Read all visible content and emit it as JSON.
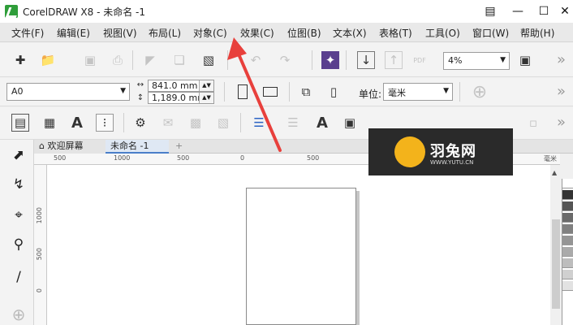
{
  "window": {
    "title": "CorelDRAW X8 - 未命名 -1",
    "buttons": {
      "minimize": "—",
      "maximize": "☐",
      "close": "✕"
    },
    "account_icon": "person-badge-icon",
    "help_icon": "lightbulb-icon"
  },
  "menubar": {
    "items": [
      "文件(F)",
      "编辑(E)",
      "视图(V)",
      "布局(L)",
      "对象(C)",
      "效果(C)",
      "位图(B)",
      "文本(X)",
      "表格(T)",
      "工具(O)",
      "窗口(W)",
      "帮助(H)"
    ]
  },
  "standard_toolbar": {
    "zoom_value": "4%",
    "pdf_label": "PDF",
    "icons": [
      "new-document-icon",
      "open-folder-icon",
      "save-icon",
      "print-icon",
      "cut-icon",
      "copy-icon",
      "paste-icon",
      "undo-icon",
      "redo-icon",
      "corel-connect-icon",
      "import-icon",
      "export-icon",
      "publish-pdf-icon",
      "full-screen-icon"
    ]
  },
  "property_bar": {
    "page_size": "A0",
    "width": "841.0 mm",
    "height": "1,189.0 mm",
    "units_label": "单位:",
    "units_value": "毫米",
    "add_icon": "plus-circle-icon"
  },
  "text_toolbar": {
    "icons": [
      "snap-icon",
      "table-grid-icon",
      "artistic-text-icon",
      "dynamic-guides-icon",
      "object-properties-icon"
    ]
  },
  "document_tabs": {
    "welcome": "欢迎屏幕",
    "document": "未命名 -1",
    "add": "+"
  },
  "ruler": {
    "h_labels": [
      "500",
      "1000",
      "500",
      "0",
      "500",
      "1000"
    ],
    "v_labels": [
      "1000",
      "500",
      "0"
    ],
    "unit": "毫米"
  },
  "watermark": {
    "title": "羽兔网",
    "subtitle": "WWW.YUTU.CN"
  },
  "colors": {
    "menubar_bg": "#e9e9e9",
    "watermark_bg": "#2a2a2a",
    "watermark_logo": "#f3b31b",
    "arrow": "#e8403c"
  },
  "palette": [
    "#ffffff",
    "#333333",
    "#555555",
    "#6a6a6a",
    "#808080",
    "#959595",
    "#aaaaaa",
    "#bdbdbd",
    "#d0d0d0",
    "#e2e2e2"
  ]
}
